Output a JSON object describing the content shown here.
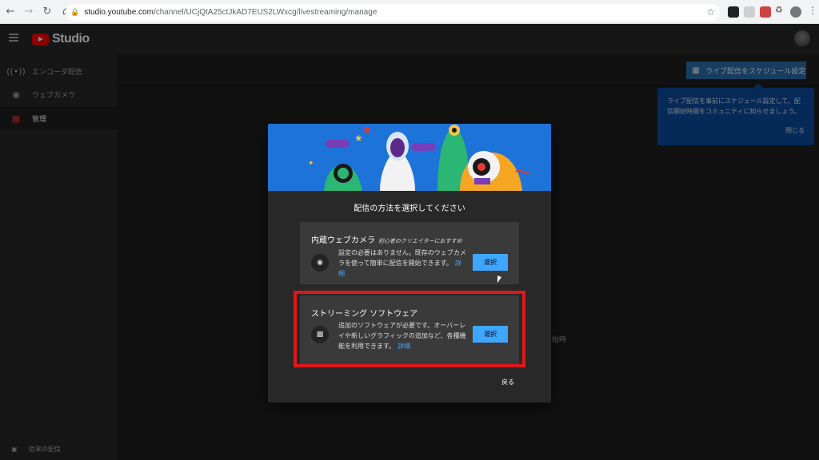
{
  "browser": {
    "url_host": "studio.youtube.com",
    "url_path": "/channel/UCjQtA25ctJkAD7EUS2LWxcg/livestreaming/manage"
  },
  "app": {
    "logo_text": "Studio",
    "sidebar": {
      "items": [
        {
          "label": "エンコーダ配信",
          "icon": "broadcast-icon"
        },
        {
          "label": "ウェブカメラ",
          "icon": "camera-icon"
        },
        {
          "label": "管理",
          "icon": "calendar-icon"
        }
      ],
      "bottom_label": "従来の配信"
    },
    "schedule_button": "ライブ配信をスケジュール設定",
    "tooltip": {
      "text": "ライブ配信を事前にスケジュール設定して、配信開始時間をコミュニティに知らせましょう。",
      "close": "閉じる"
    },
    "background_text": "始時"
  },
  "dialog": {
    "title": "配信の方法を選択してください",
    "options": [
      {
        "title": "内蔵ウェブカメラ",
        "subtitle": "初心者のクリエイターにおすすめ",
        "description": "設定の必要はありません。既存のウェブカメラを使って簡単に配信を開始できます。",
        "link": "詳細",
        "button": "選択",
        "icon": "camera-icon"
      },
      {
        "title": "ストリーミング ソフトウェア",
        "subtitle": "",
        "description": "追加のソフトウェアが必要です。オーバーレイや新しいグラフィックの追加など、各種機能を利用できます。",
        "link": "詳細",
        "button": "選択",
        "icon": "software-window-icon"
      }
    ],
    "back": "戻る"
  },
  "colors": {
    "accent_blue": "#3ea6ff",
    "highlight_red": "#e01818",
    "banner_blue": "#1e73d9"
  }
}
